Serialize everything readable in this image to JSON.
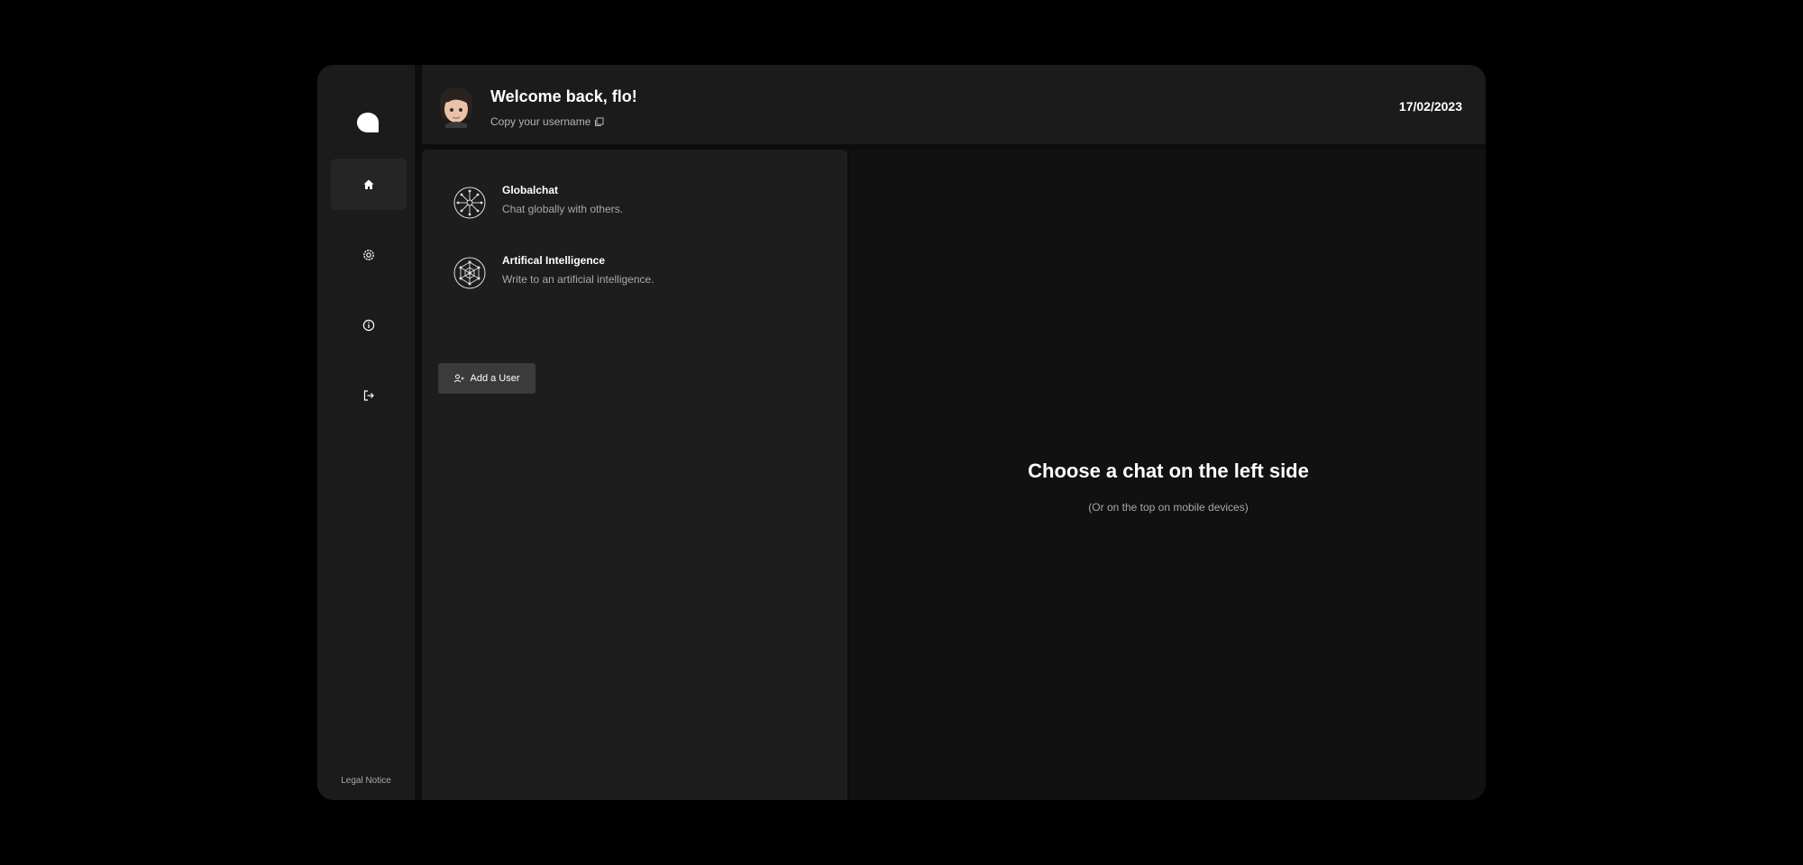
{
  "sidebar": {
    "logo_icon": "chat-bubble-icon",
    "items": [
      {
        "icon": "home-icon",
        "active": true
      },
      {
        "icon": "settings-icon",
        "active": false
      },
      {
        "icon": "info-icon",
        "active": false
      },
      {
        "icon": "logout-icon",
        "active": false
      }
    ],
    "legal_label": "Legal Notice"
  },
  "header": {
    "welcome": "Welcome back, flo!",
    "copy_label": "Copy your username",
    "copy_icon": "copy-icon",
    "date": "17/02/2023"
  },
  "chats": [
    {
      "title": "Globalchat",
      "description": "Chat globally with others.",
      "icon": "globe-network-icon"
    },
    {
      "title": "Artifical Intelligence",
      "description": "Write to an artificial intelligence.",
      "icon": "ai-network-icon"
    }
  ],
  "add_user": {
    "label": "Add a User",
    "icon": "add-user-icon"
  },
  "empty_state": {
    "title": "Choose a chat on the left side",
    "subtitle": "(Or on the top on mobile devices)"
  },
  "colors": {
    "background": "#000000",
    "sidebar": "#1b1b1c",
    "panel": "#1d1d1e",
    "main": "#111112",
    "button": "#3b3b3c"
  }
}
